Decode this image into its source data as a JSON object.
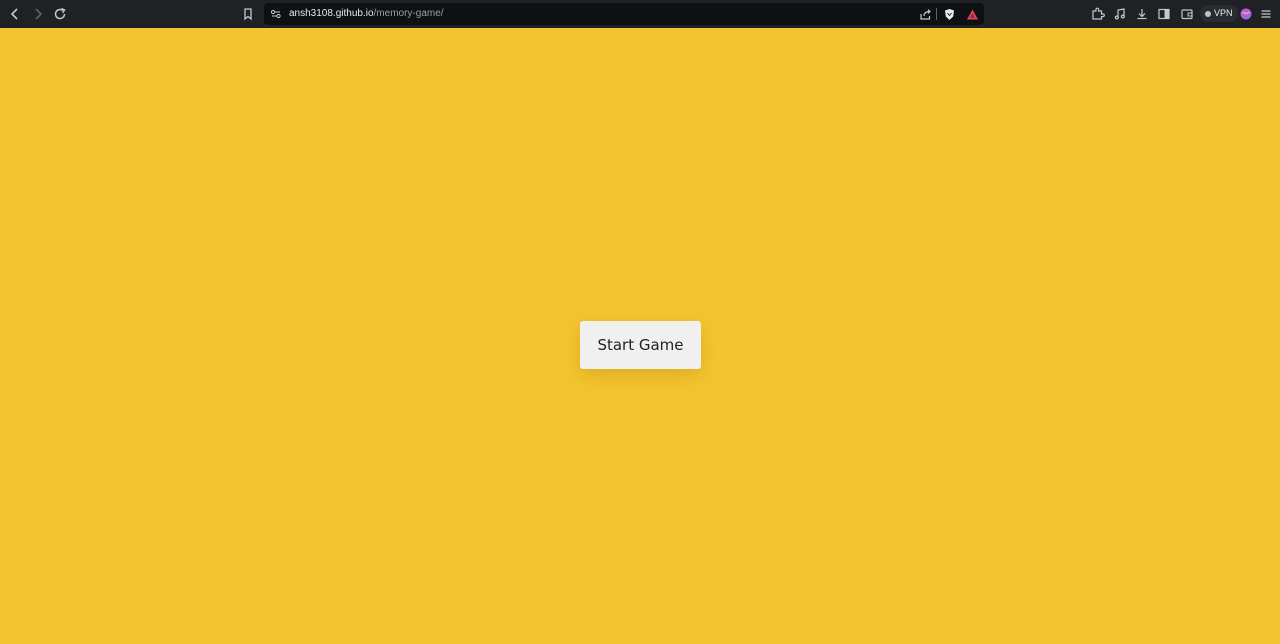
{
  "browser": {
    "url_host": "ansh3108.github.io",
    "url_path": "/memory-game/",
    "vpn_label": "VPN",
    "colors": {
      "toolbar_bg": "#202124",
      "address_bg": "#0f1013",
      "icon": "#c4c7cc"
    },
    "icons": {
      "back": "chevron-left",
      "forward": "chevron-right",
      "reload": "circular-arrow",
      "bookmark": "bookmark",
      "site_info": "tune-sliders",
      "share": "share-arrow",
      "shields": "brave-lion-shield",
      "rewards": "brave-triangle",
      "extensions": "puzzle",
      "media": "music-note",
      "downloads": "download-arrow",
      "sidebar": "sidebar-panel",
      "wallet": "wallet",
      "profile": "avatar",
      "menu": "hamburger"
    }
  },
  "page": {
    "background": "#f4c430",
    "start_button_label": "Start Game"
  }
}
